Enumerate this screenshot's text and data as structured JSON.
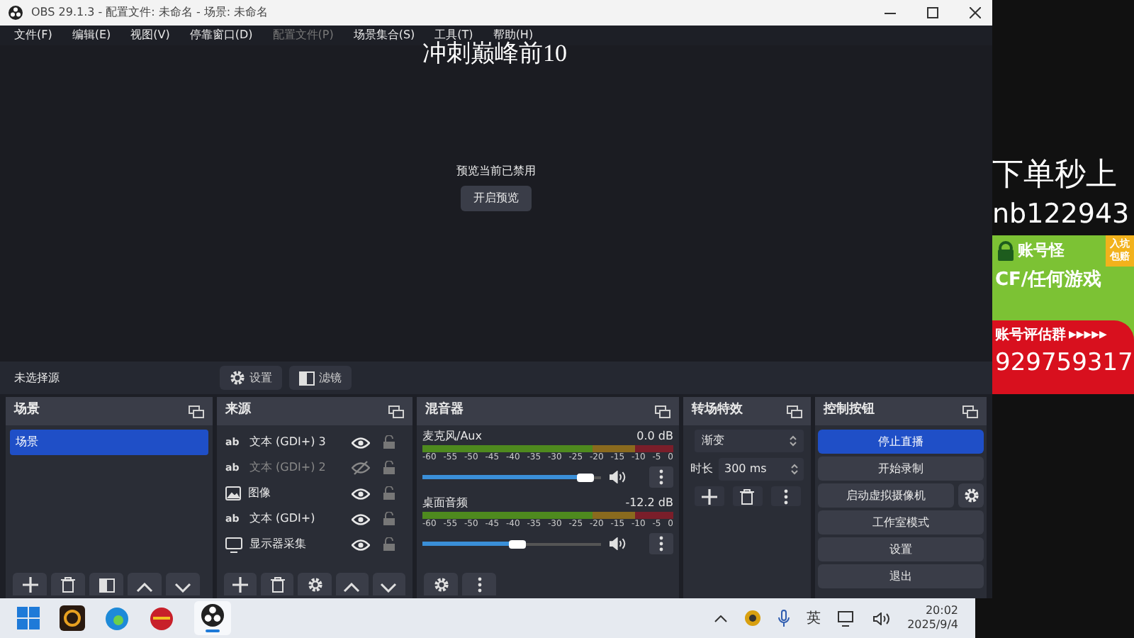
{
  "window": {
    "title": "OBS 29.1.3 - 配置文件: 未命名 - 场景: 未命名"
  },
  "menu": [
    {
      "label": "文件(F)",
      "disabled": false
    },
    {
      "label": "编辑(E)",
      "disabled": false
    },
    {
      "label": "视图(V)",
      "disabled": false
    },
    {
      "label": "停靠窗口(D)",
      "disabled": false
    },
    {
      "label": "配置文件(P)",
      "disabled": true
    },
    {
      "label": "场景集合(S)",
      "disabled": false
    },
    {
      "label": "工具(T)",
      "disabled": false
    },
    {
      "label": "帮助(H)",
      "disabled": false
    }
  ],
  "overlay_caption": "冲刺巅峰前10",
  "preview": {
    "message": "预览当前已禁用",
    "button": "开启预览"
  },
  "source_bar": {
    "label": "未选择源",
    "buttons": [
      "设置",
      "滤镜"
    ]
  },
  "scenes": {
    "title": "场景",
    "items": [
      {
        "label": "场景",
        "selected": true
      }
    ]
  },
  "sources": {
    "title": "来源",
    "items": [
      {
        "kind": "text",
        "icon_text": "ab",
        "label": "文本 (GDI+) 3",
        "visible": true
      },
      {
        "kind": "text",
        "icon_text": "ab",
        "label": "文本 (GDI+) 2",
        "visible": false
      },
      {
        "kind": "image",
        "label": "图像",
        "visible": true
      },
      {
        "kind": "text",
        "icon_text": "ab",
        "label": "文本 (GDI+)",
        "visible": true
      },
      {
        "kind": "display",
        "label": "显示器采集",
        "visible": true
      }
    ]
  },
  "mixer": {
    "title": "混音器",
    "channels": [
      {
        "name": "麦克风/Aux",
        "reading": "0.0 dB",
        "level": 0.96,
        "scale": [
          "-60",
          "-55",
          "-50",
          "-45",
          "-40",
          "-35",
          "-30",
          "-25",
          "-20",
          "-15",
          "-10",
          "-5",
          "0"
        ]
      },
      {
        "name": "桌面音频",
        "reading": "-12.2 dB",
        "level": 0.58,
        "scale": [
          "-60",
          "-55",
          "-50",
          "-45",
          "-40",
          "-35",
          "-30",
          "-25",
          "-20",
          "-15",
          "-10",
          "-5",
          "0"
        ]
      }
    ]
  },
  "transitions": {
    "title": "转场特效",
    "selected": "渐变",
    "duration_label": "时长",
    "duration": "300 ms"
  },
  "controls": {
    "title": "控制按钮",
    "buttons": [
      {
        "label": "停止直播",
        "active": true
      },
      {
        "label": "开始录制",
        "active": false
      },
      {
        "label": "启动虚拟摄像机",
        "active": false
      },
      {
        "label": "工作室模式",
        "active": false
      },
      {
        "label": "设置",
        "active": false
      },
      {
        "label": "退出",
        "active": false
      }
    ]
  },
  "side_ad": {
    "line_1": "下单秒上",
    "line_2": "nb122943",
    "brand": "账号怪",
    "badge": "入坑包赔",
    "slogan": "CF/任何游戏",
    "group_label": "账号评估群",
    "arrows": "▶▶▶▶▶",
    "group_number": "929759317"
  },
  "taskbar": {
    "tray_language": "英",
    "time": "20:02",
    "date": "2025/9/4"
  }
}
